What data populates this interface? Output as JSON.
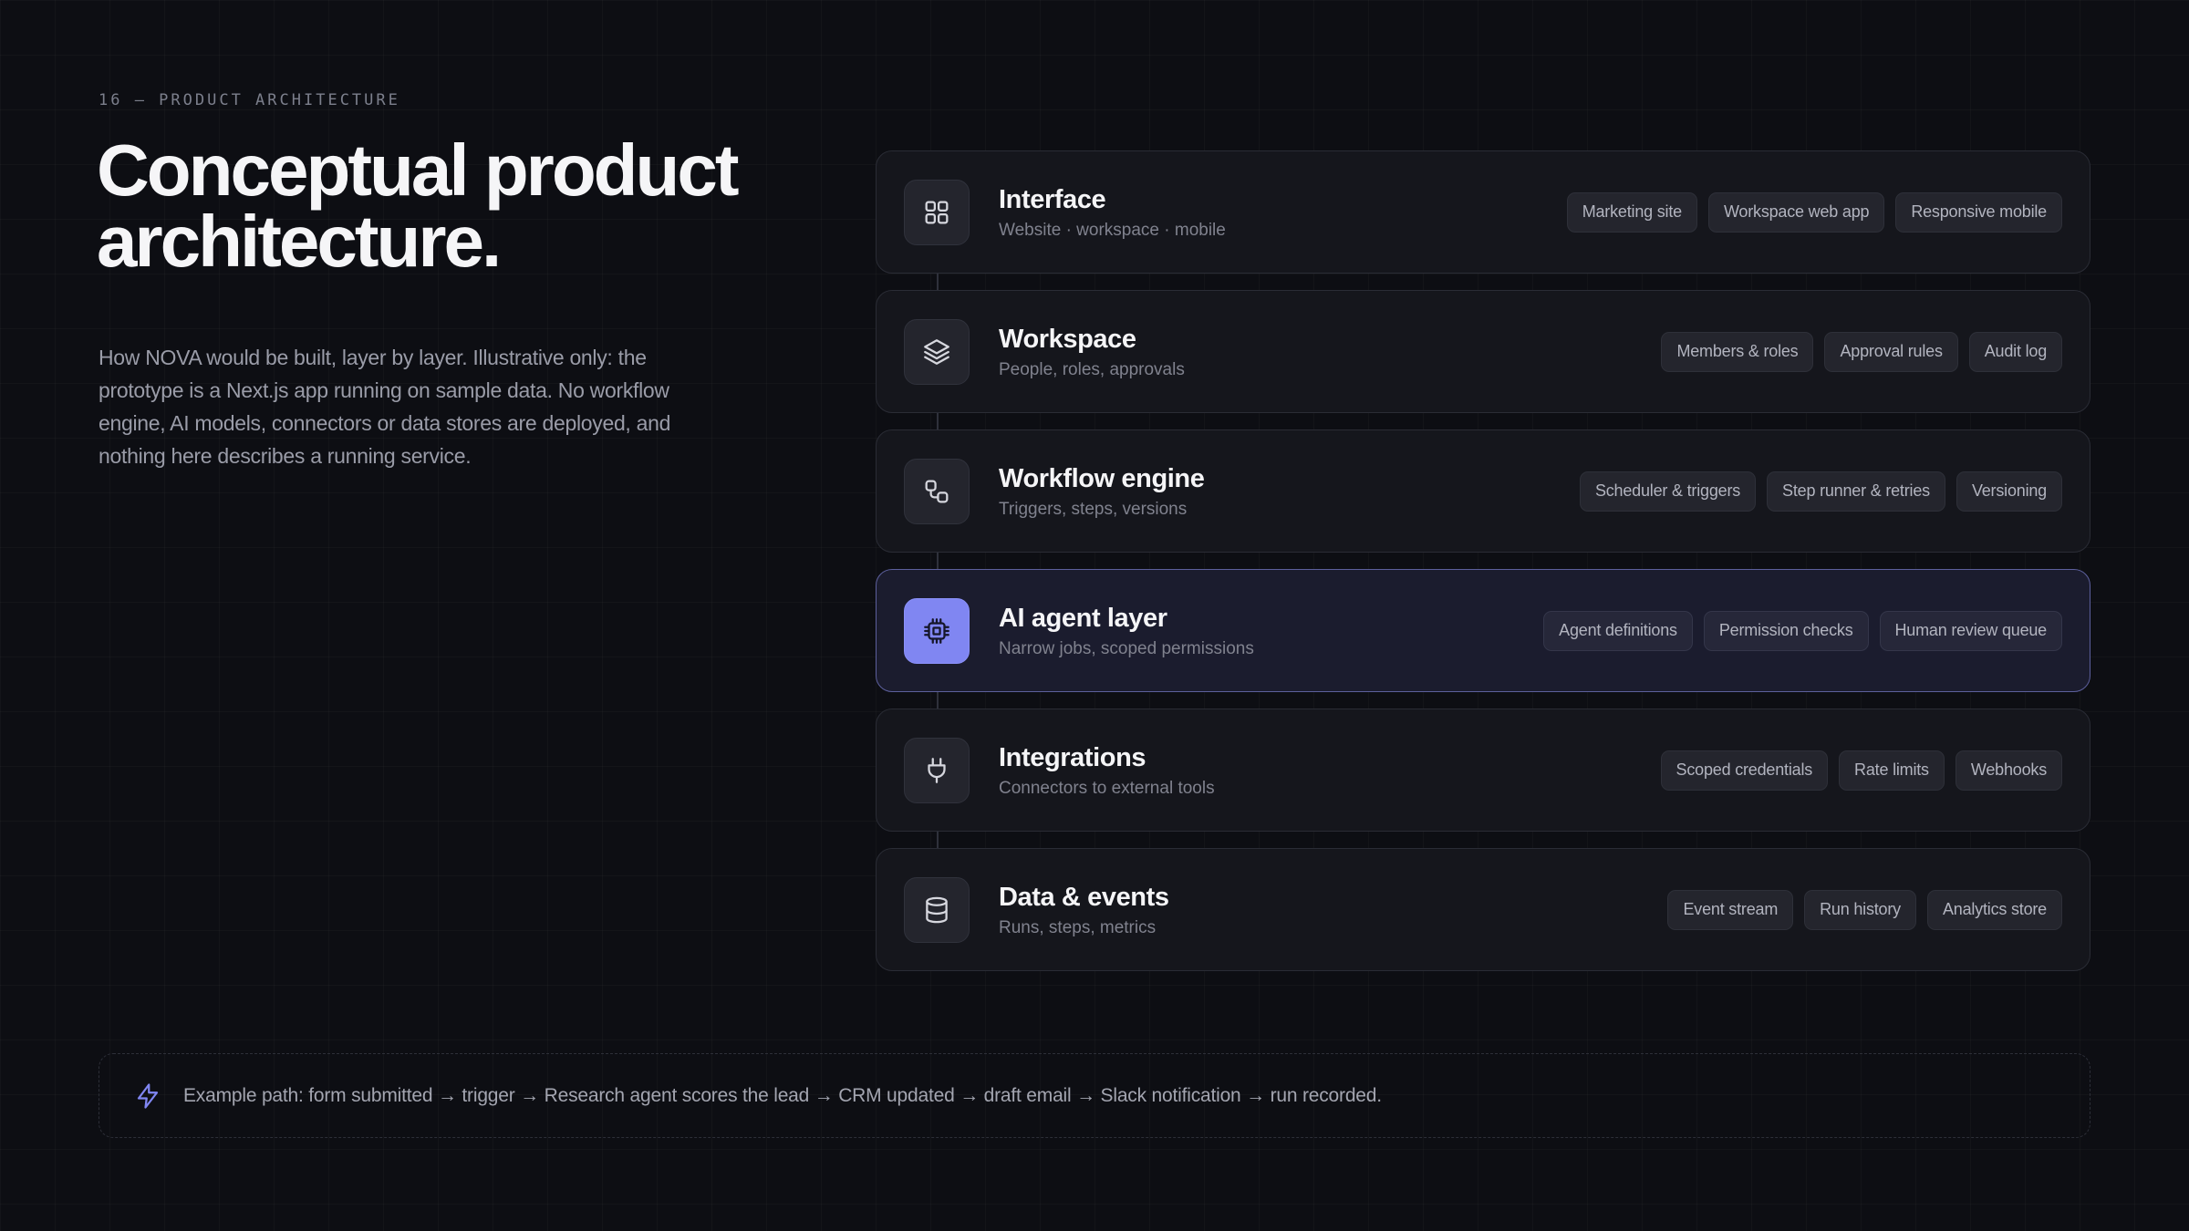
{
  "eyebrow": "16 — PRODUCT ARCHITECTURE",
  "title_line1": "Conceptual product",
  "title_line2": "architecture.",
  "description": "How NOVA would be built, layer by layer. Illustrative only: the prototype is a Next.js app running on sample data. No workflow engine, AI models, connectors or data stores are deployed, and nothing here describes a running service.",
  "accent_color": "#8086f2",
  "layers": [
    {
      "icon": "grid-icon",
      "name": "Interface",
      "subtitle": "Website · workspace · mobile",
      "chips": [
        "Marketing site",
        "Workspace web app",
        "Responsive mobile"
      ]
    },
    {
      "icon": "layers-icon",
      "name": "Workspace",
      "subtitle": "People, roles, approvals",
      "chips": [
        "Members & roles",
        "Approval rules",
        "Audit log"
      ]
    },
    {
      "icon": "workflow-icon",
      "name": "Workflow engine",
      "subtitle": "Triggers, steps, versions",
      "chips": [
        "Scheduler & triggers",
        "Step runner & retries",
        "Versioning"
      ]
    },
    {
      "icon": "cpu-icon",
      "name": "AI agent layer",
      "subtitle": "Narrow jobs, scoped permissions",
      "chips": [
        "Agent definitions",
        "Permission checks",
        "Human review queue"
      ],
      "highlighted": true
    },
    {
      "icon": "plug-icon",
      "name": "Integrations",
      "subtitle": "Connectors to external tools",
      "chips": [
        "Scoped credentials",
        "Rate limits",
        "Webhooks"
      ]
    },
    {
      "icon": "database-icon",
      "name": "Data & events",
      "subtitle": "Runs, steps, metrics",
      "chips": [
        "Event stream",
        "Run history",
        "Analytics store"
      ]
    }
  ],
  "footer": {
    "icon": "lightning-icon",
    "text": "Example path: form submitted → trigger → Research agent scores the lead → CRM updated → draft email → Slack notification → run recorded."
  }
}
